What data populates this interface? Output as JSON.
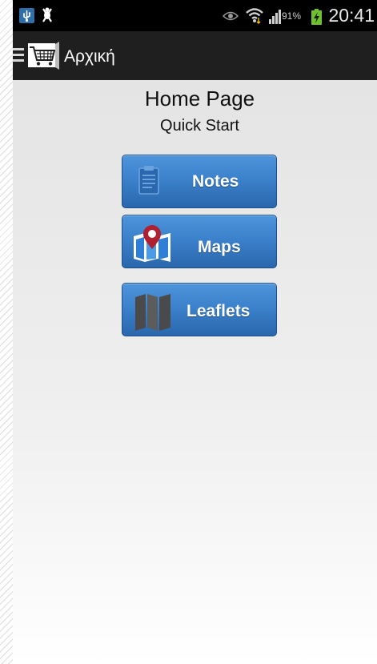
{
  "status_bar": {
    "battery_percent": "91%",
    "time": "20:41"
  },
  "action_bar": {
    "title": "Αρχική"
  },
  "main": {
    "title": "Home Page",
    "subtitle": "Quick Start",
    "buttons": [
      {
        "label": "Notes",
        "icon": "clipboard-icon"
      },
      {
        "label": "Maps",
        "icon": "map-pin-icon"
      },
      {
        "label": "Leaflets",
        "icon": "folded-map-icon"
      }
    ]
  },
  "colors": {
    "button_blue": "#3a7fc9",
    "status_bar": "#000000",
    "action_bar": "#1f1f1f",
    "map_pin": "#b0202e",
    "battery_green": "#6fc22e"
  }
}
